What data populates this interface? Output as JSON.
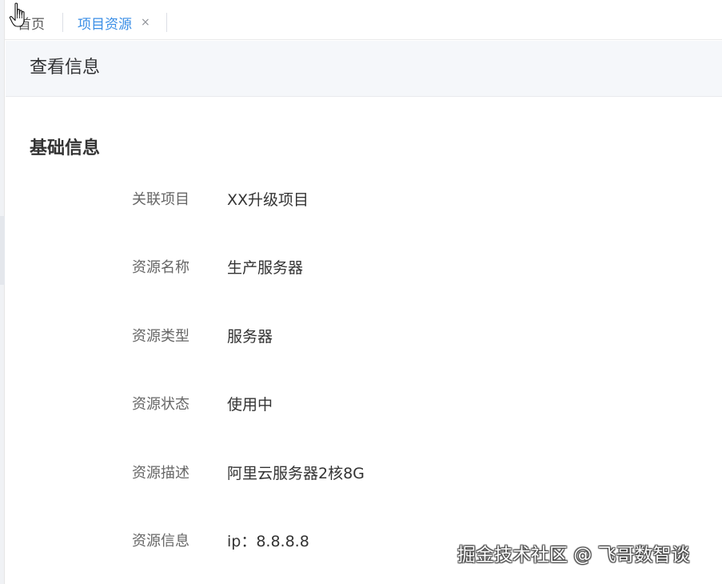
{
  "tabs": [
    {
      "label": "首页"
    },
    {
      "label": "项目资源",
      "close": "×"
    }
  ],
  "header": {
    "title": "查看信息"
  },
  "section": {
    "title": "基础信息"
  },
  "fields": [
    {
      "label": "关联项目",
      "value": "XX升级项目"
    },
    {
      "label": "资源名称",
      "value": "生产服务器"
    },
    {
      "label": "资源类型",
      "value": "服务器"
    },
    {
      "label": "资源状态",
      "value": "使用中"
    },
    {
      "label": "资源描述",
      "value": "阿里云服务器2核8G"
    },
    {
      "label": "资源信息",
      "value": "ip：8.8.8.8"
    }
  ],
  "watermark": "掘金技术社区 @ 飞哥数智谈",
  "colors": {
    "accent": "#3a8ee6",
    "header_bg": "#f5f7fa"
  },
  "icons": {
    "cursor": "hand-pointer-icon",
    "tab_close": "close-icon"
  }
}
